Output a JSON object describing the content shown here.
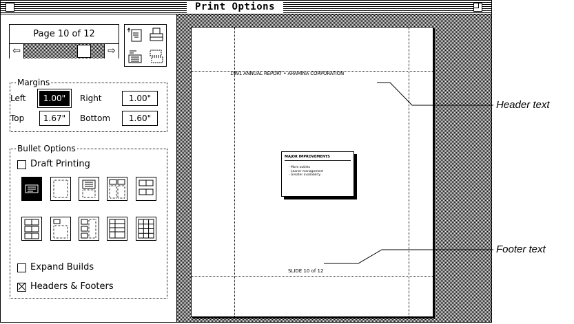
{
  "window": {
    "title": "Print Options"
  },
  "navigator": {
    "page_label": "Page 10 of 12",
    "left_arrow": "⇦",
    "right_arrow": "⇨"
  },
  "margins": {
    "group_label": "Margins",
    "left_label": "Left",
    "left_value": "1.00\"",
    "right_label": "Right",
    "right_value": "1.00\"",
    "top_label": "Top",
    "top_value": "1.67\"",
    "bottom_label": "Bottom",
    "bottom_value": "1.60\""
  },
  "bullet_options": {
    "group_label": "Bullet Options",
    "draft_printing": "Draft Printing",
    "expand_builds": "Expand Builds",
    "headers_footers": "Headers & Footers",
    "headers_footers_checked": true,
    "draft_printing_checked": false,
    "expand_builds_checked": false,
    "selected_layout_index": 0
  },
  "preview": {
    "header_text": "1991 ANNUAL REPORT  •  ARAMINA CORPORATION",
    "footer_text": "SLIDE 10 of 12",
    "slide_title": "MAJOR IMPROVEMENTS",
    "slide_bullets": [
      "- More outlets",
      "- Leaner management",
      "- Greater availability"
    ]
  },
  "callouts": {
    "header": "Header text",
    "footer": "Footer text"
  }
}
